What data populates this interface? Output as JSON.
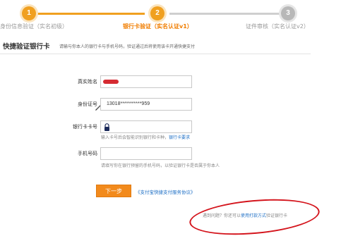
{
  "steps": [
    {
      "number": "1",
      "label": "身份信息验证（实名初级）",
      "state": "done"
    },
    {
      "number": "2",
      "label": "银行卡验证（实名认证v1）",
      "state": "active"
    },
    {
      "number": "3",
      "label": "证件审核（实名认证v2）",
      "state": "todo"
    }
  ],
  "section": {
    "title": "快捷验证银行卡",
    "description": "请输与你本人的银行卡与手机号码，验证通过后将使用该卡开通快捷支付"
  },
  "form": {
    "name_label": "真实姓名",
    "name_value": "",
    "id_label": "身份证号",
    "id_value": "13018***********959",
    "card_label": "银行卡卡号",
    "card_value": "",
    "card_hint": "输入卡号后会智能识别银行和卡种，",
    "card_hint_link": "银行卡要求",
    "phone_label": "手机号码",
    "phone_value": "",
    "phone_hint": "请填写你在银行预留的手机号码，以验证银行卡是否属于你本人"
  },
  "actions": {
    "next_label": "下一步",
    "agreement_link": "《支付宝快捷支付服务协议》"
  },
  "help": {
    "prefix": "遇到问题？你还可以",
    "link": "使用打款方式",
    "suffix": "验证银行卡"
  },
  "colors": {
    "accent": "#f0a020",
    "active_step_text": "#f07d00",
    "button": "#f28a1c",
    "link": "#1e6fc5",
    "annotation": "#d4141c"
  }
}
